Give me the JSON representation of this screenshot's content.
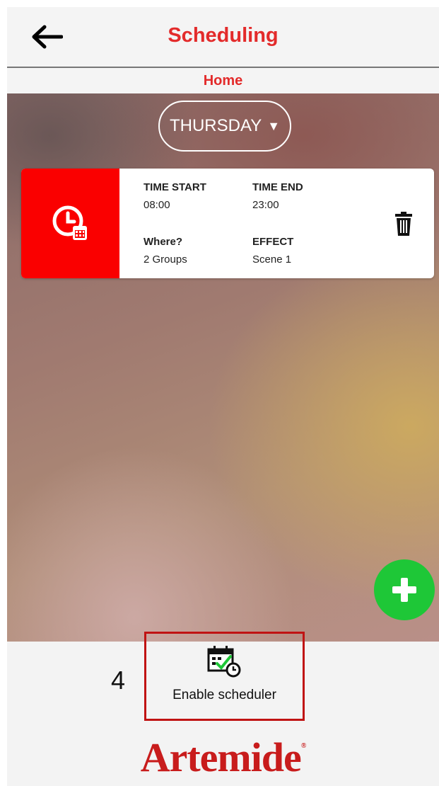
{
  "header": {
    "title": "Scheduling",
    "back_icon": "arrow-left-icon"
  },
  "subheader": {
    "location": "Home"
  },
  "day_selector": {
    "value": "THURSDAY",
    "caret": "▼"
  },
  "schedule_card": {
    "icon": "clock-calendar-icon",
    "time_start_label": "TIME START",
    "time_start_value": "08:00",
    "time_end_label": "TIME END",
    "time_end_value": "23:00",
    "where_label": "Where?",
    "where_value": "2 Groups",
    "effect_label": "EFFECT",
    "effect_value": "Scene 1",
    "delete_icon": "trash-icon"
  },
  "fab": {
    "icon": "plus-icon",
    "color": "#1ec737"
  },
  "footer": {
    "step_number": "4",
    "enable_label": "Enable scheduler",
    "enable_icon": "calendar-check-clock-icon",
    "logo_text": "Artemide",
    "logo_mark": "®"
  },
  "colors": {
    "accent": "#e32b2b",
    "card_accent": "#fa0000",
    "highlight_border": "#c01313",
    "logo": "#c81c1c"
  }
}
